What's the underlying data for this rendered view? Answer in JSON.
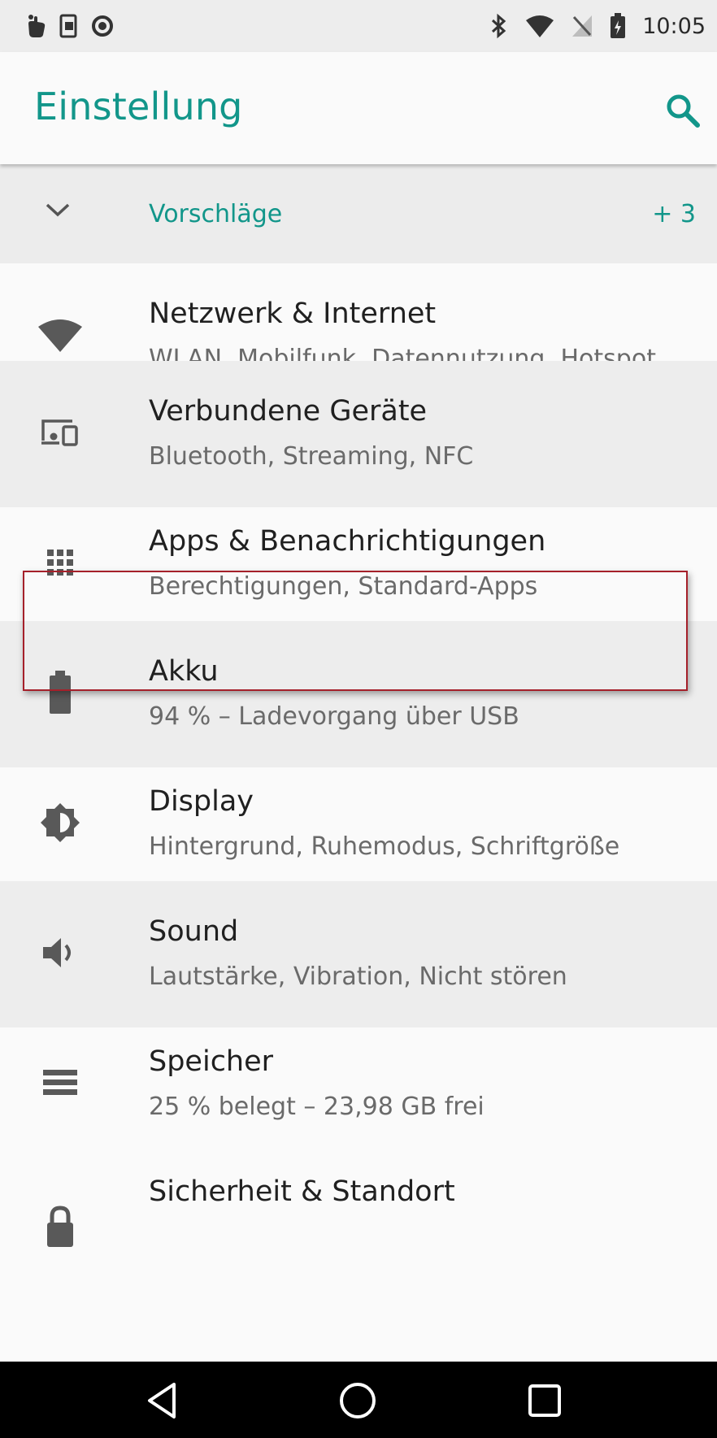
{
  "status_bar": {
    "time": "10:05",
    "left_icons": [
      "hand-pointer-icon",
      "screenshot-icon",
      "circle-icon"
    ],
    "right_icons": [
      "bluetooth-icon",
      "wifi-icon",
      "no-signal-icon",
      "battery-icon"
    ]
  },
  "app_bar": {
    "title": "Einstellung",
    "search_icon": "search-icon",
    "accent_color": "#12968a"
  },
  "suggestions": {
    "label": "Vorschläge",
    "count": "+ 3",
    "icon": "chevron-down-icon"
  },
  "settings": {
    "items": [
      {
        "title": "Netzwerk & Internet",
        "subtitle": "WLAN, Mobilfunk, Datennutzung, Hotspot",
        "icon": "wifi-icon"
      },
      {
        "title": "Verbundene Geräte",
        "subtitle": "Bluetooth, Streaming, NFC",
        "icon": "devices-icon"
      },
      {
        "title": "Apps & Benachrichtigungen",
        "subtitle": "Berechtigungen, Standard-Apps",
        "icon": "apps-grid-icon"
      },
      {
        "title": "Akku",
        "subtitle": "94 % – Ladevorgang über USB",
        "icon": "battery-icon"
      },
      {
        "title": "Display",
        "subtitle": "Hintergrund, Ruhemodus, Schriftgröße",
        "icon": "brightness-icon"
      },
      {
        "title": "Sound",
        "subtitle": "Lautstärke, Vibration, Nicht stören",
        "icon": "volume-icon"
      },
      {
        "title": "Speicher",
        "subtitle": "25 % belegt – 23,98 GB frei",
        "icon": "storage-icon"
      },
      {
        "title": "Sicherheit & Standort",
        "subtitle": "",
        "icon": "lock-icon"
      }
    ],
    "highlight_color": "#a5202a"
  },
  "nav_bar": {
    "icons": [
      "back-icon",
      "home-icon",
      "recents-icon"
    ]
  }
}
